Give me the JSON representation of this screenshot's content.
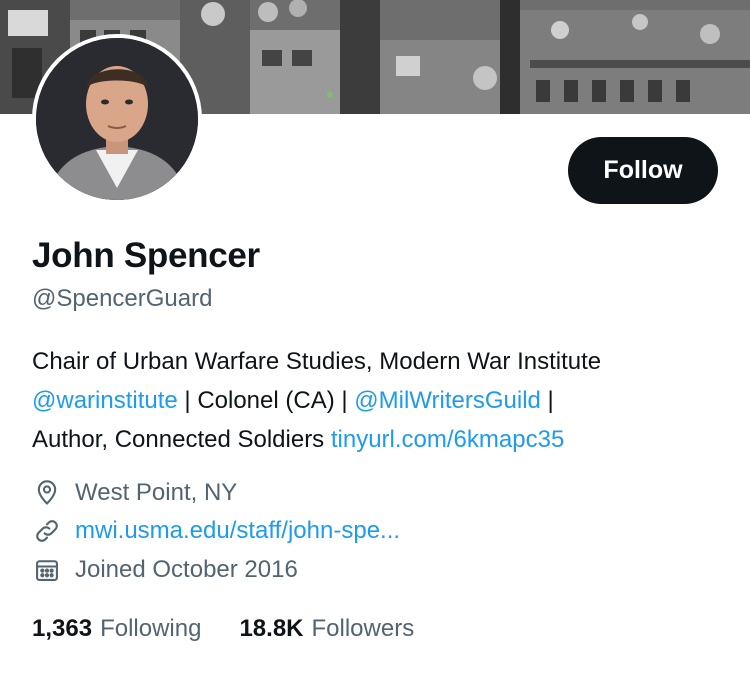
{
  "profile": {
    "display_name": "John Spencer",
    "handle": "@SpencerGuard",
    "follow_label": "Follow",
    "bio": {
      "line1_text": "Chair of Urban Warfare Studies, Modern War Institute",
      "line2_mention1": "@warinstitute",
      "line2_sep1": " | Colonel (CA) | ",
      "line2_mention2": "@MilWritersGuild",
      "line2_sep2": " |",
      "line3_text": "Author, Connected Soldiers ",
      "line3_link": "tinyurl.com/6kmapc35"
    },
    "location": "West Point, NY",
    "website": "mwi.usma.edu/staff/john-spe...",
    "joined": "Joined October 2016"
  },
  "stats": {
    "following_count": "1,363",
    "following_label": "Following",
    "followers_count": "18.8K",
    "followers_label": "Followers"
  },
  "icons": {
    "location": "map-pin-icon",
    "website": "link-icon",
    "joined": "calendar-icon"
  },
  "colors": {
    "link": "#1d9bf0",
    "secondary_text": "#536471",
    "primary_text": "#0f1419",
    "button_bg": "#0f1419"
  }
}
